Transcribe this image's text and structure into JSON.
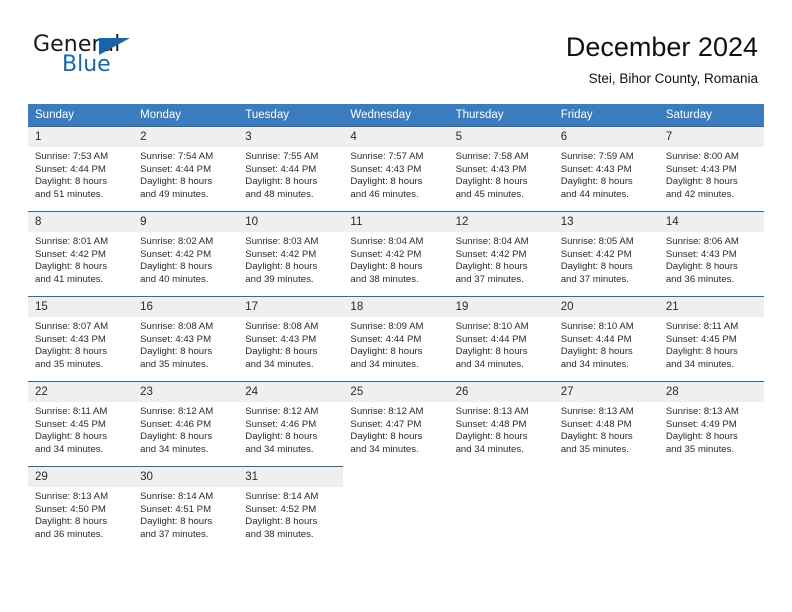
{
  "logo": {
    "word1": "General",
    "word2": "Blue",
    "triangle_color": "#1565a8",
    "blue_color": "#1769aa"
  },
  "header": {
    "title": "December 2024",
    "subtitle": "Stei, Bihor County, Romania"
  },
  "theme": {
    "header_bg": "#3a7cbe",
    "header_text": "#ffffff",
    "row_border": "#2a6aa8",
    "daynum_bg": "#efefef",
    "body_text": "#2b2b2b"
  },
  "weekday_headers": [
    "Sunday",
    "Monday",
    "Tuesday",
    "Wednesday",
    "Thursday",
    "Friday",
    "Saturday"
  ],
  "weeks": [
    [
      {
        "day": "1",
        "sunrise": "Sunrise: 7:53 AM",
        "sunset": "Sunset: 4:44 PM",
        "daylight1": "Daylight: 8 hours",
        "daylight2": "and 51 minutes."
      },
      {
        "day": "2",
        "sunrise": "Sunrise: 7:54 AM",
        "sunset": "Sunset: 4:44 PM",
        "daylight1": "Daylight: 8 hours",
        "daylight2": "and 49 minutes."
      },
      {
        "day": "3",
        "sunrise": "Sunrise: 7:55 AM",
        "sunset": "Sunset: 4:44 PM",
        "daylight1": "Daylight: 8 hours",
        "daylight2": "and 48 minutes."
      },
      {
        "day": "4",
        "sunrise": "Sunrise: 7:57 AM",
        "sunset": "Sunset: 4:43 PM",
        "daylight1": "Daylight: 8 hours",
        "daylight2": "and 46 minutes."
      },
      {
        "day": "5",
        "sunrise": "Sunrise: 7:58 AM",
        "sunset": "Sunset: 4:43 PM",
        "daylight1": "Daylight: 8 hours",
        "daylight2": "and 45 minutes."
      },
      {
        "day": "6",
        "sunrise": "Sunrise: 7:59 AM",
        "sunset": "Sunset: 4:43 PM",
        "daylight1": "Daylight: 8 hours",
        "daylight2": "and 44 minutes."
      },
      {
        "day": "7",
        "sunrise": "Sunrise: 8:00 AM",
        "sunset": "Sunset: 4:43 PM",
        "daylight1": "Daylight: 8 hours",
        "daylight2": "and 42 minutes."
      }
    ],
    [
      {
        "day": "8",
        "sunrise": "Sunrise: 8:01 AM",
        "sunset": "Sunset: 4:42 PM",
        "daylight1": "Daylight: 8 hours",
        "daylight2": "and 41 minutes."
      },
      {
        "day": "9",
        "sunrise": "Sunrise: 8:02 AM",
        "sunset": "Sunset: 4:42 PM",
        "daylight1": "Daylight: 8 hours",
        "daylight2": "and 40 minutes."
      },
      {
        "day": "10",
        "sunrise": "Sunrise: 8:03 AM",
        "sunset": "Sunset: 4:42 PM",
        "daylight1": "Daylight: 8 hours",
        "daylight2": "and 39 minutes."
      },
      {
        "day": "11",
        "sunrise": "Sunrise: 8:04 AM",
        "sunset": "Sunset: 4:42 PM",
        "daylight1": "Daylight: 8 hours",
        "daylight2": "and 38 minutes."
      },
      {
        "day": "12",
        "sunrise": "Sunrise: 8:04 AM",
        "sunset": "Sunset: 4:42 PM",
        "daylight1": "Daylight: 8 hours",
        "daylight2": "and 37 minutes."
      },
      {
        "day": "13",
        "sunrise": "Sunrise: 8:05 AM",
        "sunset": "Sunset: 4:42 PM",
        "daylight1": "Daylight: 8 hours",
        "daylight2": "and 37 minutes."
      },
      {
        "day": "14",
        "sunrise": "Sunrise: 8:06 AM",
        "sunset": "Sunset: 4:43 PM",
        "daylight1": "Daylight: 8 hours",
        "daylight2": "and 36 minutes."
      }
    ],
    [
      {
        "day": "15",
        "sunrise": "Sunrise: 8:07 AM",
        "sunset": "Sunset: 4:43 PM",
        "daylight1": "Daylight: 8 hours",
        "daylight2": "and 35 minutes."
      },
      {
        "day": "16",
        "sunrise": "Sunrise: 8:08 AM",
        "sunset": "Sunset: 4:43 PM",
        "daylight1": "Daylight: 8 hours",
        "daylight2": "and 35 minutes."
      },
      {
        "day": "17",
        "sunrise": "Sunrise: 8:08 AM",
        "sunset": "Sunset: 4:43 PM",
        "daylight1": "Daylight: 8 hours",
        "daylight2": "and 34 minutes."
      },
      {
        "day": "18",
        "sunrise": "Sunrise: 8:09 AM",
        "sunset": "Sunset: 4:44 PM",
        "daylight1": "Daylight: 8 hours",
        "daylight2": "and 34 minutes."
      },
      {
        "day": "19",
        "sunrise": "Sunrise: 8:10 AM",
        "sunset": "Sunset: 4:44 PM",
        "daylight1": "Daylight: 8 hours",
        "daylight2": "and 34 minutes."
      },
      {
        "day": "20",
        "sunrise": "Sunrise: 8:10 AM",
        "sunset": "Sunset: 4:44 PM",
        "daylight1": "Daylight: 8 hours",
        "daylight2": "and 34 minutes."
      },
      {
        "day": "21",
        "sunrise": "Sunrise: 8:11 AM",
        "sunset": "Sunset: 4:45 PM",
        "daylight1": "Daylight: 8 hours",
        "daylight2": "and 34 minutes."
      }
    ],
    [
      {
        "day": "22",
        "sunrise": "Sunrise: 8:11 AM",
        "sunset": "Sunset: 4:45 PM",
        "daylight1": "Daylight: 8 hours",
        "daylight2": "and 34 minutes."
      },
      {
        "day": "23",
        "sunrise": "Sunrise: 8:12 AM",
        "sunset": "Sunset: 4:46 PM",
        "daylight1": "Daylight: 8 hours",
        "daylight2": "and 34 minutes."
      },
      {
        "day": "24",
        "sunrise": "Sunrise: 8:12 AM",
        "sunset": "Sunset: 4:46 PM",
        "daylight1": "Daylight: 8 hours",
        "daylight2": "and 34 minutes."
      },
      {
        "day": "25",
        "sunrise": "Sunrise: 8:12 AM",
        "sunset": "Sunset: 4:47 PM",
        "daylight1": "Daylight: 8 hours",
        "daylight2": "and 34 minutes."
      },
      {
        "day": "26",
        "sunrise": "Sunrise: 8:13 AM",
        "sunset": "Sunset: 4:48 PM",
        "daylight1": "Daylight: 8 hours",
        "daylight2": "and 34 minutes."
      },
      {
        "day": "27",
        "sunrise": "Sunrise: 8:13 AM",
        "sunset": "Sunset: 4:48 PM",
        "daylight1": "Daylight: 8 hours",
        "daylight2": "and 35 minutes."
      },
      {
        "day": "28",
        "sunrise": "Sunrise: 8:13 AM",
        "sunset": "Sunset: 4:49 PM",
        "daylight1": "Daylight: 8 hours",
        "daylight2": "and 35 minutes."
      }
    ],
    [
      {
        "day": "29",
        "sunrise": "Sunrise: 8:13 AM",
        "sunset": "Sunset: 4:50 PM",
        "daylight1": "Daylight: 8 hours",
        "daylight2": "and 36 minutes."
      },
      {
        "day": "30",
        "sunrise": "Sunrise: 8:14 AM",
        "sunset": "Sunset: 4:51 PM",
        "daylight1": "Daylight: 8 hours",
        "daylight2": "and 37 minutes."
      },
      {
        "day": "31",
        "sunrise": "Sunrise: 8:14 AM",
        "sunset": "Sunset: 4:52 PM",
        "daylight1": "Daylight: 8 hours",
        "daylight2": "and 38 minutes."
      },
      {
        "day": "",
        "sunrise": "",
        "sunset": "",
        "daylight1": "",
        "daylight2": ""
      },
      {
        "day": "",
        "sunrise": "",
        "sunset": "",
        "daylight1": "",
        "daylight2": ""
      },
      {
        "day": "",
        "sunrise": "",
        "sunset": "",
        "daylight1": "",
        "daylight2": ""
      },
      {
        "day": "",
        "sunrise": "",
        "sunset": "",
        "daylight1": "",
        "daylight2": ""
      }
    ]
  ]
}
